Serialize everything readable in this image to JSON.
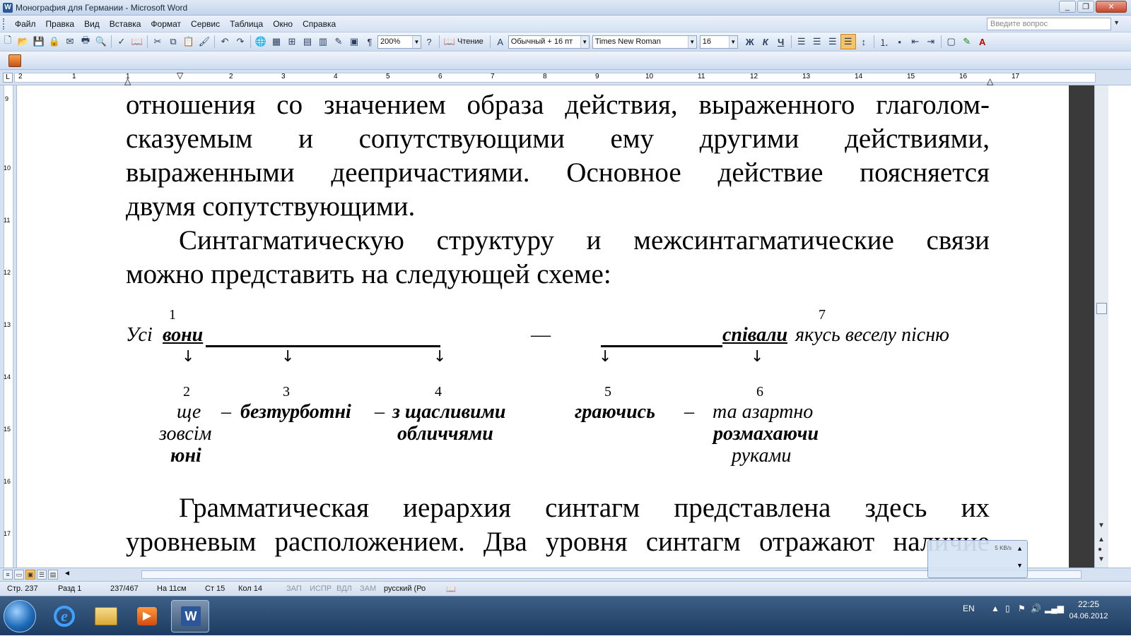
{
  "window": {
    "title": "Монография для Германии - Microsoft Word",
    "buttons": [
      "_",
      "❐",
      "✕"
    ]
  },
  "menu": {
    "items": [
      "Файл",
      "Правка",
      "Вид",
      "Вставка",
      "Формат",
      "Сервис",
      "Таблица",
      "Окно",
      "Справка"
    ],
    "ask_placeholder": "Введите вопрос"
  },
  "toolbar": {
    "zoom": "200%",
    "read_label": "Чтение",
    "style": "Обычный + 16 пт",
    "font": "Times New Roman",
    "size": "16",
    "bold": "Ж",
    "italic": "К",
    "underline": "Ч"
  },
  "ruler": {
    "h_numbers": [
      "2",
      "1",
      "1",
      "2",
      "3",
      "4",
      "5",
      "6",
      "7",
      "8",
      "9",
      "10",
      "11",
      "12",
      "13",
      "14",
      "15",
      "16",
      "17"
    ],
    "v_numbers": [
      "9",
      "10",
      "11",
      "12",
      "13",
      "14",
      "15",
      "16",
      "17"
    ]
  },
  "document": {
    "para1_lines": [
      "отношения со значением образа действия, выраженного глаголом-",
      "сказуемым и сопутствующими ему другими действиями,",
      "выраженными деепричастиями. Основное действие поясняется",
      "двумя сопутствующими."
    ],
    "para2_lines": [
      "Синтагматическую структуру и межсинтагматические связи",
      "можно представить на следующей схеме:"
    ],
    "para3_lines": [
      "Грамматическая иерархия синтагм представлена здесь их",
      "уровневым расположением. Два уровня синтагм отражают наличие"
    ],
    "scheme": {
      "numbers": [
        "1",
        "2",
        "3",
        "4",
        "5",
        "6",
        "7"
      ],
      "top_usi": "Усі ",
      "top_voni": "вони",
      "dash": "—",
      "top_spivaly": "співали",
      "top_rest": " якусь веселу пісню",
      "arrow": "↓",
      "small_dash": "–",
      "w2_line1": "ще",
      "w2_line2": "зовсім",
      "w2_line3": "юні",
      "w3": "безтурботні",
      "w4_line1": "з щасливими",
      "w4_line2": "обличчями",
      "w5": "граючись",
      "w6_line1": "та азартно",
      "w6_line2": "розмахаючи",
      "w6_line3": "руками"
    }
  },
  "status": {
    "page": "Стр. 237",
    "section": "Разд 1",
    "pages": "237/467",
    "at": "На 11см",
    "line": "Ст 15",
    "col": "Кол 14",
    "rec": "ЗАП",
    "trk": "ИСПР",
    "ext": "ВДЛ",
    "ovr": "ЗАМ",
    "lang": "русский (Ро"
  },
  "net_widget": {
    "speed": "5 KB/s"
  },
  "taskbar": {
    "lang": "EN",
    "time": "22:25",
    "date": "04.06.2012"
  }
}
